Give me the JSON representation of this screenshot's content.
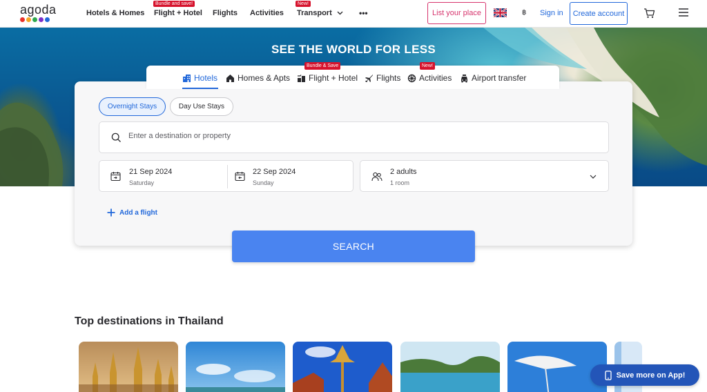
{
  "header": {
    "logo_text": "agoda",
    "logo_dot_colors": [
      "#e9322b",
      "#f6a623",
      "#2fa84f",
      "#7b2fc9",
      "#2067da"
    ],
    "nav": [
      {
        "label": "Hotels & Homes"
      },
      {
        "label": "Flight + Hotel",
        "badge": "Bundle and save!"
      },
      {
        "label": "Flights"
      },
      {
        "label": "Activities"
      },
      {
        "label": "Transport",
        "badge": "New!"
      }
    ],
    "more_label": "•••",
    "list_your_place": "List your place",
    "language_icon": "uk-flag-icon",
    "currency": "฿",
    "sign_in": "Sign in",
    "create_account": "Create account"
  },
  "hero": {
    "title": "SEE THE WORLD FOR LESS"
  },
  "search_tabs": [
    {
      "label": "Hotels",
      "icon": "hotel-icon",
      "active": true
    },
    {
      "label": "Homes & Apts",
      "icon": "home-icon"
    },
    {
      "label": "Flight + Hotel",
      "icon": "flight-hotel-icon",
      "badge": "Bundle & Save"
    },
    {
      "label": "Flights",
      "icon": "plane-icon"
    },
    {
      "label": "Activities",
      "icon": "activities-icon",
      "badge": "New!"
    },
    {
      "label": "Airport transfer",
      "icon": "car-icon"
    }
  ],
  "stay_type": {
    "overnight": "Overnight Stays",
    "day_use": "Day Use Stays"
  },
  "destination": {
    "placeholder": "Enter a destination or property"
  },
  "checkin": {
    "date": "21 Sep 2024",
    "day": "Saturday"
  },
  "checkout": {
    "date": "22 Sep 2024",
    "day": "Sunday"
  },
  "guests": {
    "adults": "2 adults",
    "rooms": "1 room"
  },
  "add_flight": "Add a flight",
  "search_button": "SEARCH",
  "destinations_section": {
    "title": "Top destinations in Thailand"
  },
  "app_button": "Save more on App!",
  "colors": {
    "accent": "#2067da",
    "search_button": "#4a84f0",
    "badge": "#d6132d",
    "list_place": "#d6336c"
  }
}
